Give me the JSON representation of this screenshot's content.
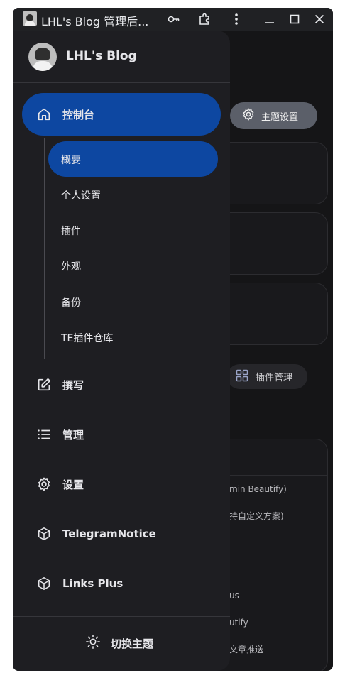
{
  "window": {
    "title": "LHL's Blog 管理后..."
  },
  "site": {
    "name": "LHL's Blog"
  },
  "nav": {
    "console": "控制台",
    "sub_items": [
      "概要",
      "个人设置",
      "插件",
      "外观",
      "备份",
      "TE插件仓库"
    ],
    "write": "撰写",
    "manage": "管理",
    "settings": "设置",
    "telegram": "TelegramNotice",
    "links_plus": "Links Plus"
  },
  "footer": {
    "switch_theme": "切换主题"
  },
  "background": {
    "theme_settings": "主题设置",
    "plugin_management": "插件管理",
    "list_fragments": [
      "min Beautify)",
      "持自定义方案)",
      "us",
      "utify",
      "文章推送"
    ]
  },
  "colors": {
    "accent": "#0d47a1",
    "drawer": "#1e1e22",
    "page": "#151517"
  }
}
